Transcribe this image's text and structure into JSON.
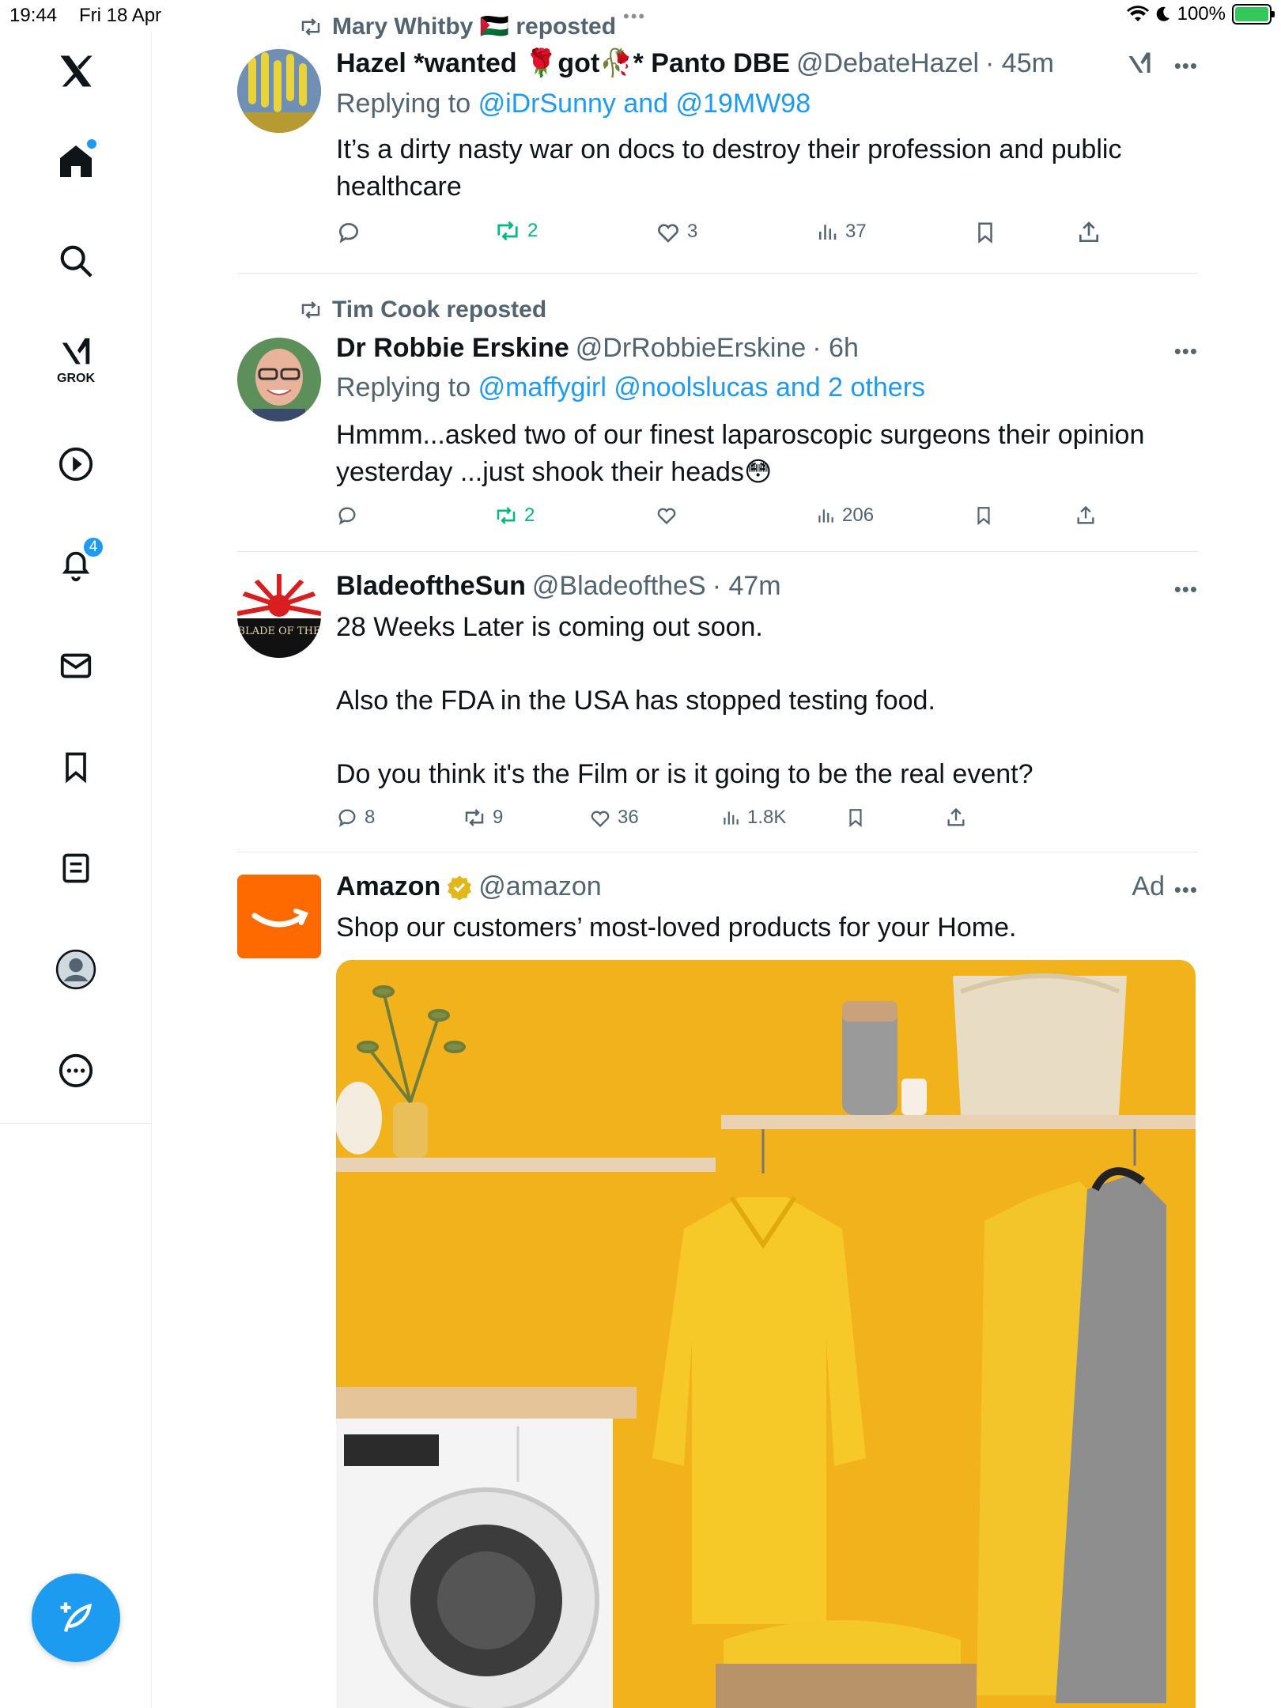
{
  "status": {
    "time": "19:44",
    "date": "Fri 18 Apr",
    "battery": "100%"
  },
  "sidebar": {
    "notifications_badge": "4",
    "grok_label": "GROK"
  },
  "posts": [
    {
      "repost_by": "Mary Whitby 🇵🇸 reposted",
      "name": "Hazel *wanted 🌹got🥀* Panto DBE",
      "handle": "@DebateHazel",
      "time": "· 45m",
      "replying_prefix": "Replying to",
      "replying_to": "@iDrSunny and @19MW98",
      "text": "It’s a dirty nasty war on docs to destroy their profession and public healthcare",
      "reposts": "2",
      "likes": "3",
      "views": "37"
    },
    {
      "repost_by": "Tim Cook reposted",
      "name": "Dr Robbie Erskine",
      "handle": "@DrRobbieErskine",
      "time": "· 6h",
      "replying_prefix": "Replying to",
      "replying_to": "@maffygirl @noolslucas and 2 others",
      "text": "Hmmm...asked two of our finest laparoscopic surgeons their opinion yesterday ...just shook their heads😳",
      "reposts": "2",
      "views": "206"
    },
    {
      "name": "BladeoftheSun",
      "handle": "@BladeoftheS",
      "time": "· 47m",
      "avatar_text": "BLADE OF THE",
      "text_lines": [
        "28 Weeks Later is coming out soon.",
        "Also the FDA in the USA has stopped testing food.",
        "Do you think it's the Film or is it going to be the real event?"
      ],
      "replies": "8",
      "reposts": "9",
      "likes": "36",
      "views": "1.8K"
    },
    {
      "name": "Amazon",
      "handle": "@amazon",
      "ad_label": "Ad",
      "text": "Shop our customers’ most-loved products for your Home."
    }
  ],
  "colors": {
    "accent": "#1d9bf0",
    "repost_green": "#00ba7c",
    "secondary_text": "#536471",
    "amazon_orange": "#ff6a00",
    "ad_background": "#f2b21b"
  }
}
